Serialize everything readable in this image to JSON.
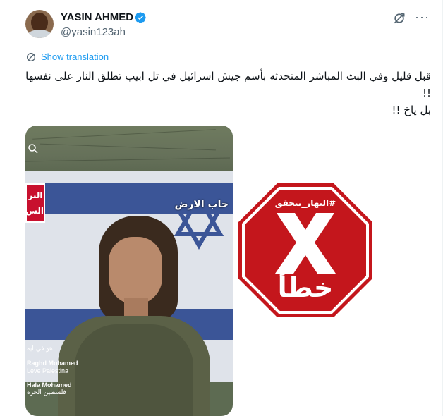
{
  "tweet": {
    "author": {
      "display_name": "YASIN AHMED",
      "handle": "@yasin123ah",
      "verified": true,
      "verified_color": "#1d9bf0"
    },
    "show_translation_label": "Show translation",
    "text_lines": [
      "قبل قليل وفي البث المباشر المتحدثه بأسم جيش اسرائيل في تل ابيب تطلق النار على نفسها !!",
      "بل ياخ !!"
    ],
    "icons": {
      "verified": "verified-badge-icon",
      "grok": "grok-icon",
      "more": "more-options-icon",
      "translate": "translate-icon"
    }
  },
  "media": {
    "overlay_caption": "حاب الارض",
    "channel_logo_text": "البر الس",
    "comments": [
      {
        "text": "هو في ايه",
        "rtl": true
      },
      {
        "text": "Raghd Mohamed",
        "rtl": false
      },
      {
        "text": "Leve Palestina",
        "rtl": false
      },
      {
        "text": "Hala Mohamed",
        "rtl": false
      },
      {
        "text": "فلسطين الحرة",
        "rtl": true
      }
    ]
  },
  "fact_check": {
    "tag": "#النهار_تتحقق",
    "verdict": "خطأ",
    "color": "#c4161c"
  }
}
